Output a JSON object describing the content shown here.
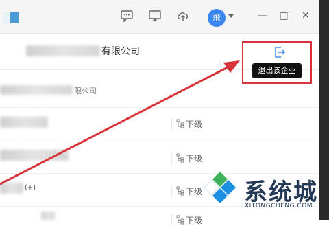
{
  "titlebar": {
    "avatar_text": "飛",
    "icons": [
      "chat-icon",
      "screen-share-icon",
      "cloud-upload-icon",
      "chevron-down-icon"
    ],
    "window_controls": {
      "minimize": "—",
      "maximize": "□",
      "close": "✕"
    }
  },
  "company": {
    "name_suffix": "有限公司",
    "exit_tooltip": "退出该企业",
    "exit_icon": "exit-icon"
  },
  "sub_company": {
    "name_suffix": "限公司"
  },
  "rows": [
    {
      "level_label": "下级"
    },
    {
      "level_label": "下级"
    },
    {
      "level_label": "下级"
    },
    {
      "level_label": "下级"
    }
  ],
  "row_fragment": "(+)",
  "watermark": {
    "title": "系统城",
    "subtitle": "XITONGCHENG.COM"
  },
  "colors": {
    "accent_blue": "#3b87ef",
    "highlight_red": "#d9333a",
    "watermark_navy": "#243a57"
  }
}
